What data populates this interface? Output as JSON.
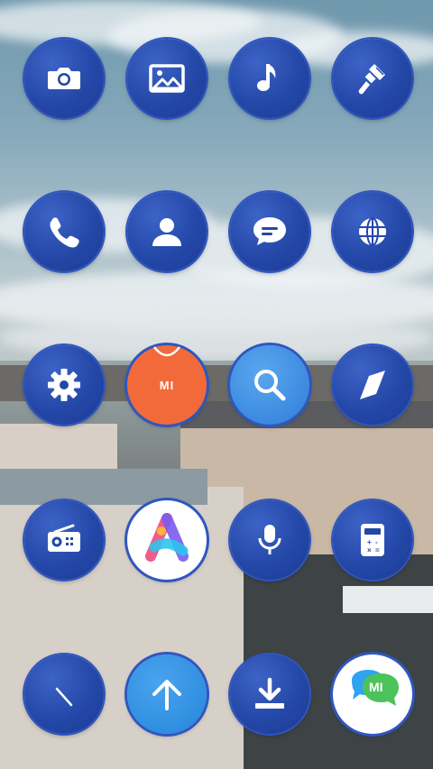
{
  "screen": {
    "wallpaper": "paris-rooftops-sky",
    "accent_color": "#2448a8"
  },
  "apps": [
    {
      "name": "camera",
      "icon": "camera-icon"
    },
    {
      "name": "gallery",
      "icon": "image-icon"
    },
    {
      "name": "music",
      "icon": "music-note-icon"
    },
    {
      "name": "themes",
      "icon": "paintbrush-icon"
    },
    {
      "name": "phone",
      "icon": "phone-icon"
    },
    {
      "name": "contacts",
      "icon": "person-icon"
    },
    {
      "name": "messages",
      "icon": "chat-bubble-icon"
    },
    {
      "name": "browser",
      "icon": "globe-icon"
    },
    {
      "name": "settings",
      "icon": "gear-icon"
    },
    {
      "name": "mi-store",
      "icon": "shopping-bag-icon",
      "label": "MI"
    },
    {
      "name": "search",
      "icon": "search-icon"
    },
    {
      "name": "compass",
      "icon": "compass-icon"
    },
    {
      "name": "fm-radio",
      "icon": "radio-icon"
    },
    {
      "name": "app-vault",
      "icon": "colorful-a-icon"
    },
    {
      "name": "recorder",
      "icon": "microphone-icon"
    },
    {
      "name": "calculator",
      "icon": "calculator-icon"
    },
    {
      "name": "clock",
      "icon": "clock-hand-icon"
    },
    {
      "name": "updater",
      "icon": "arrow-up-icon"
    },
    {
      "name": "downloads",
      "icon": "download-icon"
    },
    {
      "name": "mi-chat",
      "icon": "mi-chat-bubbles-icon",
      "label": "MI"
    }
  ]
}
